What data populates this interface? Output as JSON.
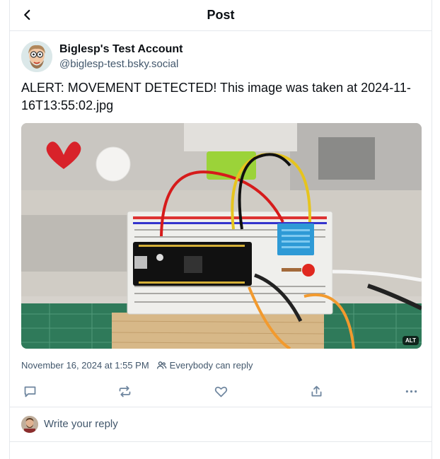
{
  "header": {
    "title": "Post"
  },
  "post": {
    "author": {
      "display_name": "Biglesp's Test Account",
      "handle": "@biglesp-test.bsky.social"
    },
    "text": "ALERT: MOVEMENT DETECTED! This image was taken at 2024-11-16T13:55:02.jpg",
    "media": {
      "alt_badge": "ALT"
    },
    "timestamp": "November 16, 2024 at 1:55 PM",
    "reply_setting": "Everybody can reply"
  },
  "reply_box": {
    "placeholder": "Write your reply"
  },
  "icons": {
    "back": "chevron-left-icon",
    "reply": "speech-bubble-icon",
    "repost": "repost-arrows-icon",
    "like": "heart-icon",
    "share": "share-upload-icon",
    "more": "ellipsis-icon",
    "reply_setting": "people-icon"
  },
  "colors": {
    "accent": "#1083fe",
    "muted_text": "#42576c",
    "border": "#e5e8ec",
    "icon": "#6f869f"
  }
}
